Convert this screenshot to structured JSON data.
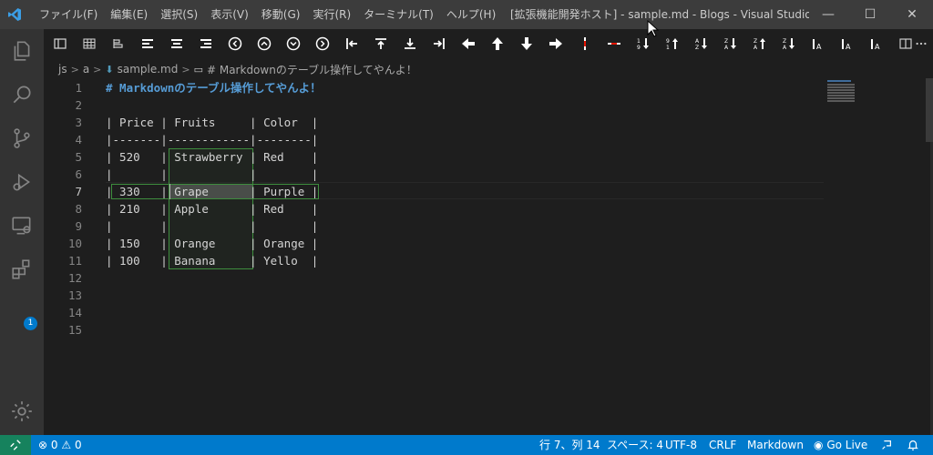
{
  "titlebar": {
    "menus": [
      "ファイル(F)",
      "編集(E)",
      "選択(S)",
      "表示(V)",
      "移動(G)",
      "実行(R)",
      "ターミナル(T)",
      "ヘルプ(H)"
    ],
    "title": "[拡張機能開発ホスト] - sample.md - Blogs - Visual Studio Co...",
    "minimize": "—",
    "maximize": "☐",
    "close": "✕"
  },
  "activitybar": {
    "icons": [
      "explorer-icon",
      "search-icon",
      "source-control-icon",
      "run-debug-icon",
      "remote-explorer-icon",
      "extensions-icon"
    ],
    "extensions_badge": "1",
    "settings": "gear-icon"
  },
  "toolbar": {
    "buttons": [
      "toggle-preview",
      "table-grid",
      "align-table",
      "align-left",
      "align-center",
      "align-right",
      "move-left-circle",
      "move-up-circle",
      "move-down-circle",
      "move-right-circle",
      "jump-first",
      "jump-top",
      "jump-bottom",
      "jump-last",
      "arrow-left",
      "arrow-up",
      "arrow-down",
      "arrow-right",
      "insert-column",
      "insert-row",
      "sort-num-asc",
      "sort-num-desc",
      "sort-alpha-asc",
      "sort-alpha-desc",
      "sort-az",
      "sort-za",
      "font-a-1",
      "font-a-2",
      "font-a-3",
      "split-editor",
      "more-actions"
    ]
  },
  "breadcrumb": {
    "items": [
      "js",
      "a",
      "sample.md",
      "# Markdownのテーブル操作してやんよ！"
    ],
    "separator": ">"
  },
  "editor": {
    "line_numbers": [
      "1",
      "2",
      "3",
      "4",
      "5",
      "6",
      "7",
      "8",
      "9",
      "10",
      "11",
      "12",
      "13",
      "14",
      "15"
    ],
    "active_line": "7",
    "lines": [
      "# Markdownのテーブル操作してやんよ！",
      "",
      "| Price | Fruits     | Color  |",
      "|-------|------------|--------|",
      "| 520   | Strawberry | Red    |",
      "|       |            |        |",
      "| 330   | Grape      | Purple |",
      "| 210   | Apple      | Red    |",
      "|       |            |        |",
      "| 150   | Orange     | Orange |",
      "| 100   | Banana     | Yello  |",
      "",
      "",
      "",
      ""
    ]
  },
  "statusbar": {
    "remote_icon": "remote-icon",
    "errors": "0",
    "warnings": "0",
    "position": "行 7、列 14",
    "spaces": "スペース: 4",
    "encoding": "UTF-8",
    "eol": "CRLF",
    "language": "Markdown",
    "golive": "Go Live",
    "feedback_icon": "feedback-icon",
    "bell_icon": "bell-icon"
  },
  "colors": {
    "accent": "#007acc",
    "heading": "#569cd6",
    "selection_border": "#3e8e3e",
    "badge": "#007acc"
  }
}
